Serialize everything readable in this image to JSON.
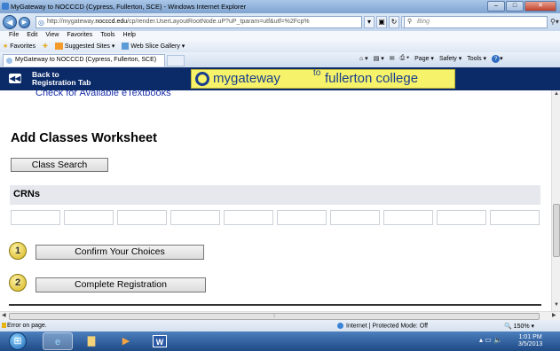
{
  "window": {
    "title": "MyGateway to NOCCCD (Cypress, Fullerton, SCE) - Windows Internet Explorer",
    "controls": [
      "–",
      "□",
      "✕"
    ]
  },
  "addressbar": {
    "url_prefix": "http://mygateway.",
    "url_domain": "nocccd.edu",
    "url_rest": "/cp/render.UserLayoutRootNode.uP?uP_tparam=utf&utf=%2Fcp%",
    "search_placeholder": "Bing"
  },
  "menu": [
    "File",
    "Edit",
    "View",
    "Favorites",
    "Tools",
    "Help"
  ],
  "favorites_bar": {
    "favorites": "Favorites",
    "suggested": "Suggested Sites ▾",
    "slice": "Web Slice Gallery ▾"
  },
  "tab": {
    "label": "MyGateway to NOCCCD (Cypress, Fullerton, SCE)"
  },
  "commands": {
    "page": "Page ▾",
    "safety": "Safety ▾",
    "tools": "Tools ▾"
  },
  "gateway": {
    "back_line1": "Back to",
    "back_line2": "Registration Tab",
    "logo_mygateway": "mygateway",
    "logo_to": "to",
    "logo_college": "fullerton college"
  },
  "content": {
    "etextbooks_link": "Check for Available eTextbooks",
    "title": "Add Classes Worksheet",
    "class_search_button": "Class Search",
    "crn_heading": "CRNs",
    "crn_fields": [
      "",
      "",
      "",
      "",
      "",
      "",
      "",
      "",
      "",
      ""
    ],
    "step1_number": "1",
    "confirm_button": "Confirm Your Choices",
    "step2_number": "2",
    "complete_button": "Complete Registration"
  },
  "status": {
    "error": "Error on page.",
    "zone": "Internet | Protected Mode: Off",
    "zoom": "150%"
  },
  "taskbar": {
    "time": "1:01 PM",
    "date": "3/5/2013"
  }
}
